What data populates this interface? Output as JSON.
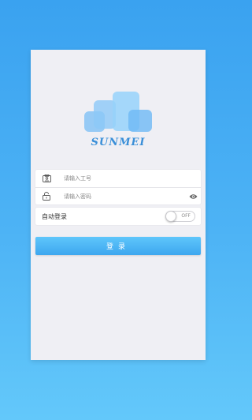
{
  "brand": {
    "logo_text": "SUNMEI"
  },
  "form": {
    "employee_id": {
      "value": "",
      "placeholder": "请输入工号",
      "icon": "id-card-icon"
    },
    "password": {
      "value": "",
      "placeholder": "请输入密码",
      "icon": "lock-icon",
      "toggle_icon": "eye-icon"
    }
  },
  "auto_login": {
    "label": "自动登录",
    "state_text": "OFF",
    "enabled": false
  },
  "login_button": {
    "label": "登录"
  },
  "colors": {
    "accent": "#3ea7ef",
    "background_top": "#3aa2f0",
    "background_bottom": "#63c8fa",
    "card": "#efeff4"
  }
}
